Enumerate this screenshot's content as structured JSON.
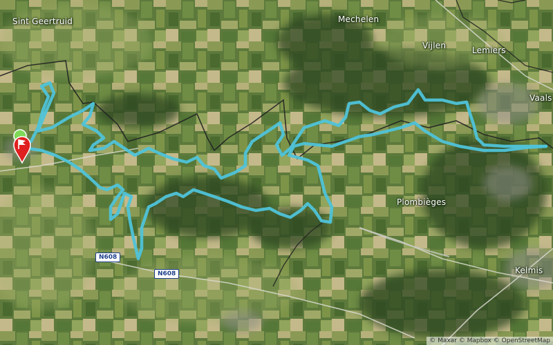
{
  "map": {
    "type": "satellite",
    "route_color": "#4fc3d9",
    "border_color": "#222222",
    "start_marker_color": "#e02020",
    "finish_marker_color": "#7ed957"
  },
  "places": {
    "sint_geertruid": "Sint Geertruid",
    "mechelen": "Mechelen",
    "vijlen": "Vijlen",
    "lemiers": "Lemiers",
    "vaals": "Vaals",
    "plombieges": "Plombièges",
    "kelmis": "Kelmis"
  },
  "roads": {
    "n608_a": "N608",
    "n608_b": "N608"
  },
  "attribution": "© Maxar © Mapbox © OpenStreetMap"
}
